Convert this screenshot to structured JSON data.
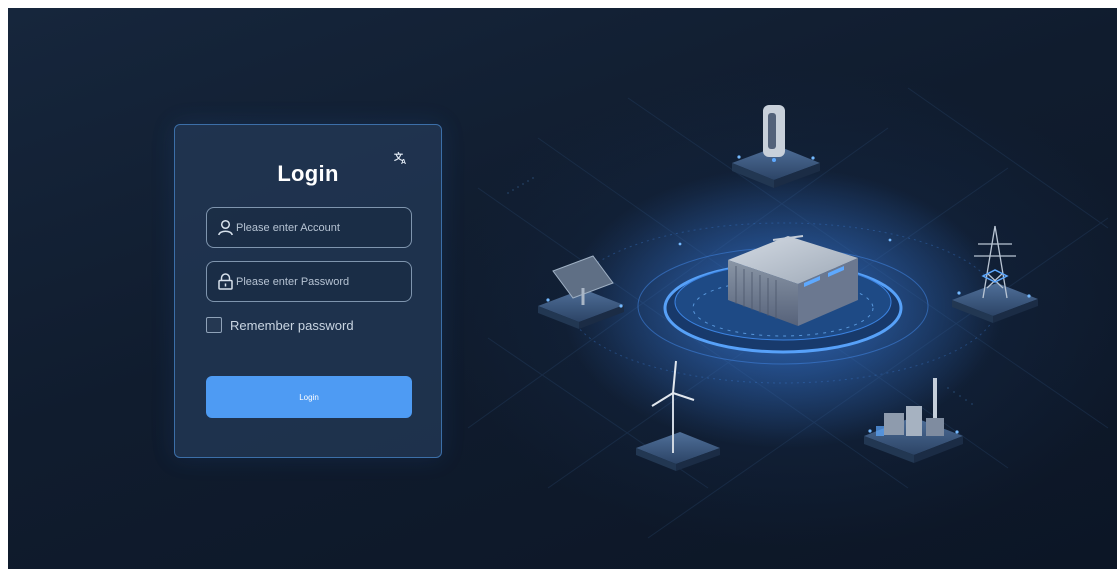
{
  "login": {
    "title": "Login",
    "language_icon": "translate-icon",
    "account": {
      "placeholder": "Please enter Account",
      "value": "",
      "icon": "user-icon"
    },
    "password": {
      "placeholder": "Please enter Password",
      "value": "",
      "icon": "lock-icon"
    },
    "remember": {
      "label": "Remember password",
      "checked": false
    },
    "submit_label": "Login"
  },
  "theme": {
    "background": "#101c2e",
    "card_border": "#3c6fa8",
    "button": "#4e9bf3",
    "accent_glow": "#3f8cff"
  },
  "illustration": {
    "central": "battery-storage-unit-icon",
    "peripherals": [
      "ev-charger-icon",
      "solar-panel-icon",
      "transmission-tower-icon",
      "wind-turbine-icon",
      "factory-icon"
    ]
  }
}
